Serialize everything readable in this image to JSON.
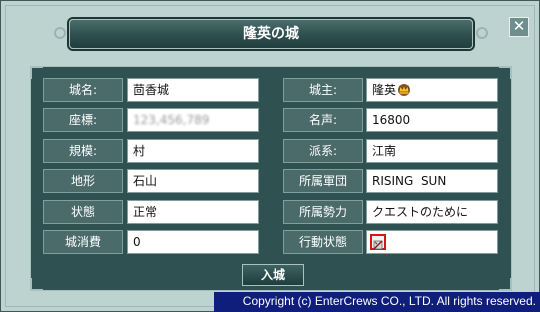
{
  "window": {
    "title": "隆英の城",
    "close_glyph": "✕"
  },
  "left_rows": [
    {
      "label": "城名:",
      "value": "茴香城"
    },
    {
      "label": "座標:",
      "value": "123,456,789"
    },
    {
      "label": "規模:",
      "value": "村"
    },
    {
      "label": "地形",
      "value": "石山"
    },
    {
      "label": "状態",
      "value": "正常"
    },
    {
      "label": "城消費",
      "value": "0"
    }
  ],
  "right_rows": [
    {
      "label": "城主:",
      "value": "隆英"
    },
    {
      "label": "名声:",
      "value": "16800"
    },
    {
      "label": "派系:",
      "value": "江南"
    },
    {
      "label": "所属軍団",
      "value": "RISING  SUN"
    },
    {
      "label": "所属勢力",
      "value": "クエストのために"
    },
    {
      "label": "行動状態",
      "value": ""
    }
  ],
  "icons": {
    "owner_badge": "crown-icon",
    "action_status": "action-status-icon"
  },
  "enter_button": {
    "label": "入城"
  },
  "footer": {
    "copyright": "Copyright (c) EnterCrews CO., LTD. All rights reserved."
  },
  "colors": {
    "panel": "#2f5151",
    "label_bg": "#4b6b6b",
    "footer_bg": "#0f1e7a",
    "status_border": "#d01818"
  }
}
